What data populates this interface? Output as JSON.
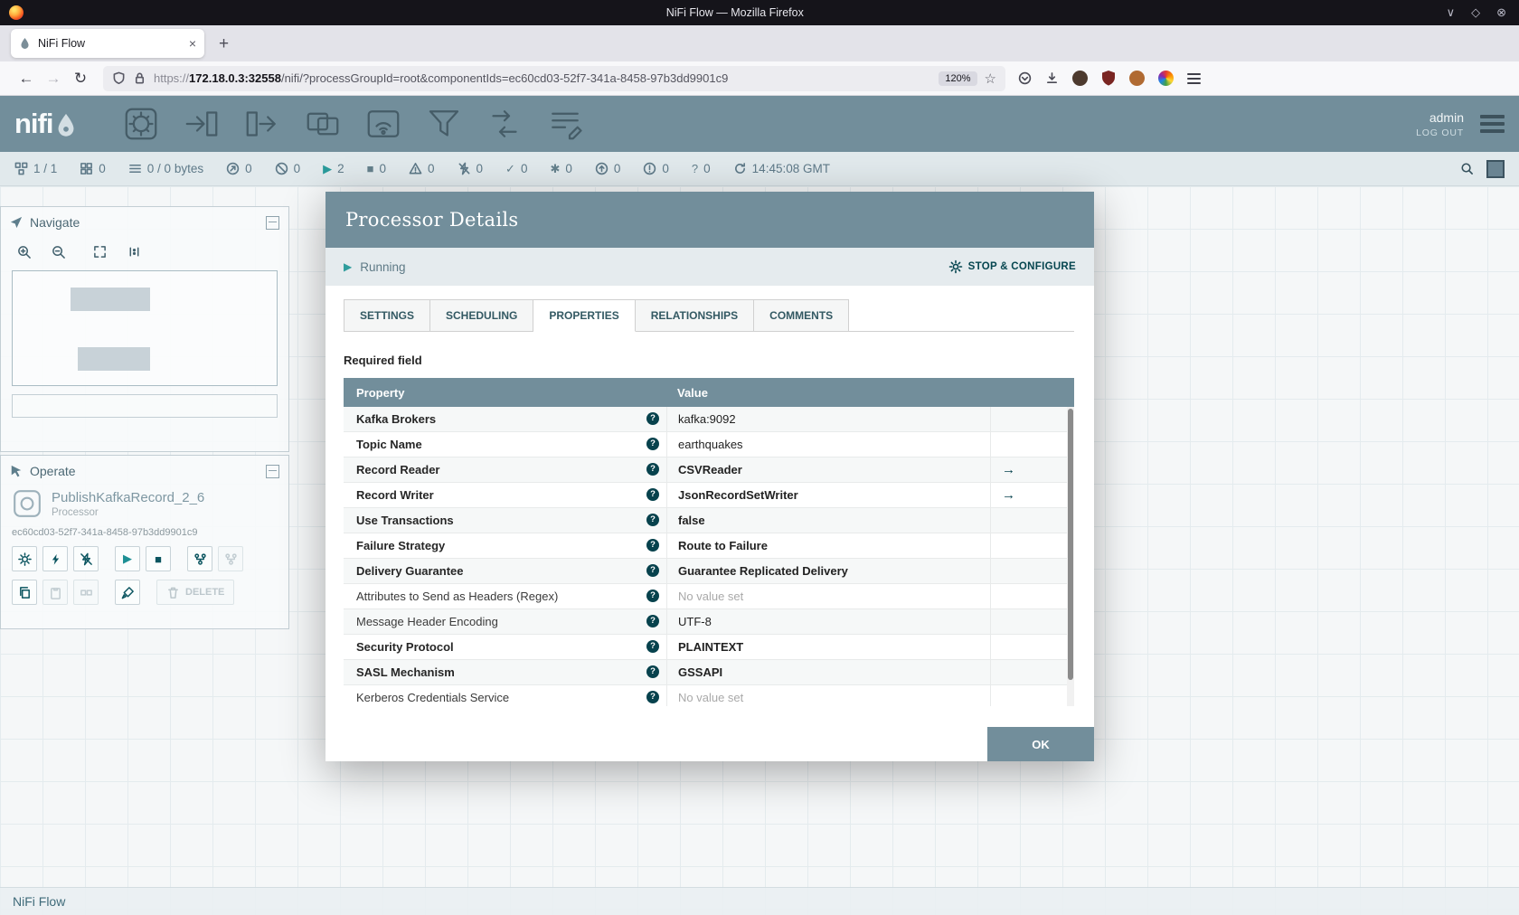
{
  "window": {
    "title": "NiFi Flow — Mozilla Firefox",
    "controls": [
      "minimize-icon",
      "maximize-icon",
      "close-icon"
    ]
  },
  "browser": {
    "tab_title": "NiFi Flow",
    "new_tab": "+",
    "url_scheme": "https://",
    "url_host": "172.18.0.3:32558",
    "url_path": "/nifi/?processGroupId=root&componentIds=ec60cd03-52f7-341a-8458-97b3dd9901c9",
    "zoom_badge": "120%"
  },
  "nifi_header": {
    "logo": "nifi",
    "tools": [
      "processor",
      "input-port",
      "output-port",
      "process-group",
      "remote-process-group",
      "funnel",
      "template",
      "label"
    ],
    "user": "admin",
    "logout": "LOG OUT"
  },
  "statusbar": {
    "items": [
      {
        "icon": "cluster-icon",
        "value": "1 / 1"
      },
      {
        "icon": "threads-icon",
        "value": "0"
      },
      {
        "icon": "queued-icon",
        "value": "0 / 0 bytes"
      },
      {
        "icon": "transmitting-icon",
        "value": "0"
      },
      {
        "icon": "not-transmitting-icon",
        "value": "0"
      },
      {
        "icon": "running-icon",
        "value": "2"
      },
      {
        "icon": "stopped-icon",
        "value": "0"
      },
      {
        "icon": "invalid-icon",
        "value": "0"
      },
      {
        "icon": "disabled-icon",
        "value": "0"
      },
      {
        "icon": "up-to-date-icon",
        "value": "0"
      },
      {
        "icon": "locally-modified-icon",
        "value": "0"
      },
      {
        "icon": "stale-icon",
        "value": "0"
      },
      {
        "icon": "locally-modified-stale-icon",
        "value": "0"
      },
      {
        "icon": "sync-failure-icon",
        "value": "0"
      }
    ],
    "time": "14:45:08 GMT"
  },
  "navigate": {
    "title": "Navigate"
  },
  "operate": {
    "title": "Operate",
    "component_name": "PublishKafkaRecord_2_6",
    "component_type": "Processor",
    "component_id": "ec60cd03-52f7-341a-8458-97b3dd9901c9",
    "delete_label": "DELETE"
  },
  "breadcrumb": "NiFi Flow",
  "dialog": {
    "title": "Processor Details",
    "run_status": "Running",
    "stop_configure_label": "STOP & CONFIGURE",
    "tabs": [
      {
        "label": "SETTINGS"
      },
      {
        "label": "SCHEDULING"
      },
      {
        "label": "PROPERTIES"
      },
      {
        "label": "RELATIONSHIPS"
      },
      {
        "label": "COMMENTS"
      }
    ],
    "active_tab": "PROPERTIES",
    "required_note": "Required field",
    "table": {
      "col_property": "Property",
      "col_value": "Value",
      "rows": [
        {
          "property": "Kafka Brokers",
          "value": "kafka:9092"
        },
        {
          "property": "Topic Name",
          "value": "earthquakes"
        },
        {
          "property": "Record Reader",
          "value": "CSVReader"
        },
        {
          "property": "Record Writer",
          "value": "JsonRecordSetWriter"
        },
        {
          "property": "Use Transactions",
          "value": "false"
        },
        {
          "property": "Failure Strategy",
          "value": "Route to Failure"
        },
        {
          "property": "Delivery Guarantee",
          "value": "Guarantee Replicated Delivery"
        },
        {
          "property": "Attributes to Send as Headers (Regex)",
          "value": "No value set"
        },
        {
          "property": "Message Header Encoding",
          "value": "UTF-8"
        },
        {
          "property": "Security Protocol",
          "value": "PLAINTEXT"
        },
        {
          "property": "SASL Mechanism",
          "value": "GSSAPI"
        },
        {
          "property": "Kerberos Credentials Service",
          "value": "No value set"
        }
      ]
    },
    "ok_label": "OK"
  },
  "colors": {
    "nifi_header": "#728e9b",
    "dark_teal": "#004849",
    "running_teal": "#2f9d9d",
    "status_bar_bg": "#e1e9ec"
  }
}
